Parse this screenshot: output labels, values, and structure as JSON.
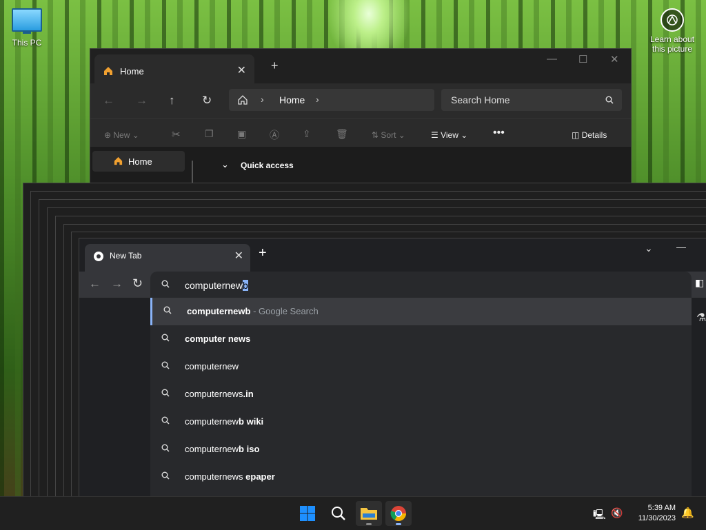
{
  "desktop": {
    "icon_label": "This PC",
    "learn_label_1": "Learn about",
    "learn_label_2": "this picture"
  },
  "explorer": {
    "tab_title": "Home",
    "breadcrumb": "Home",
    "search_placeholder": "Search Home",
    "commands": {
      "new": "New",
      "sort": "Sort",
      "view": "View",
      "details": "Details"
    },
    "sidebar_home": "Home",
    "quick_access": "Quick access"
  },
  "chrome": {
    "tab_title": "New Tab",
    "omnibox_typed": "computernew",
    "omnibox_autocomplete": "b",
    "suggestions": [
      {
        "main": "computernewb",
        "bold": "",
        "hint": " - Google Search"
      },
      {
        "main": "",
        "bold": "computer news",
        "hint": ""
      },
      {
        "main": "computernew",
        "bold": "",
        "hint": ""
      },
      {
        "main": "computernews",
        "bold": ".in",
        "hint": ""
      },
      {
        "main": "computernew",
        "bold": "b wiki",
        "hint": ""
      },
      {
        "main": "computernew",
        "bold": "b iso",
        "hint": ""
      },
      {
        "main": "computernews",
        "bold": " epaper",
        "hint": ""
      }
    ]
  },
  "taskbar": {
    "time": "5:39 AM",
    "date": "11/30/2023"
  },
  "colors": {
    "accent": "#8ab4f8",
    "windows_blue": "#1e90ff"
  }
}
